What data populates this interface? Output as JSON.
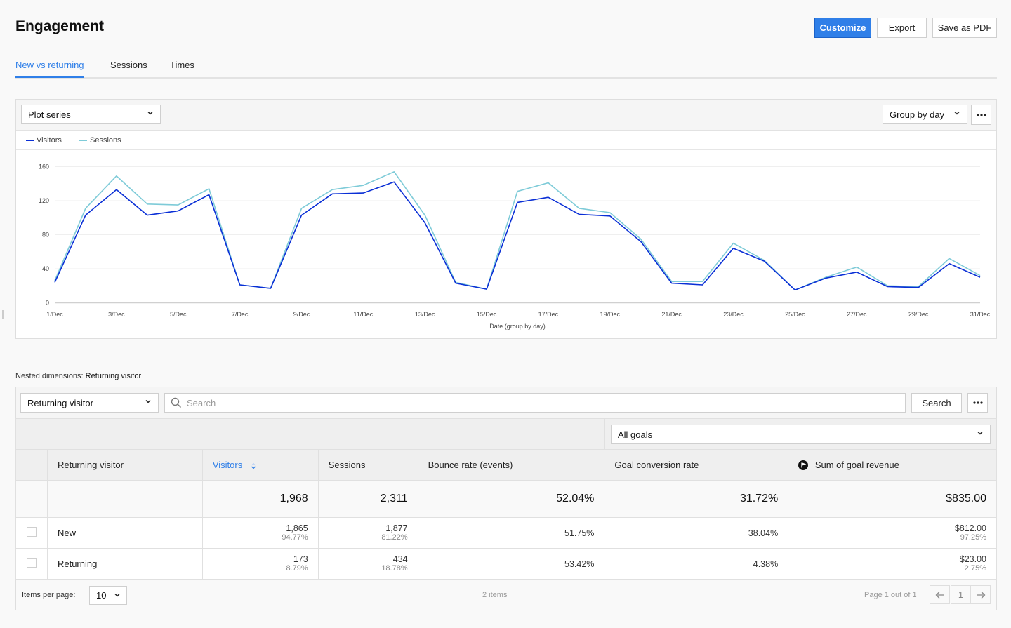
{
  "header": {
    "title": "Engagement",
    "customize_label": "Customize",
    "export_label": "Export",
    "save_pdf_label": "Save as PDF"
  },
  "tabs": [
    {
      "label": "New vs returning",
      "active": true
    },
    {
      "label": "Sessions",
      "active": false
    },
    {
      "label": "Times",
      "active": false
    }
  ],
  "chart_panel": {
    "plot_series_label": "Plot series",
    "group_by_label": "Group by day",
    "more_icon": "ellipsis-icon"
  },
  "colors": {
    "accent": "#2f7fe8",
    "visitors_line": "#0a2fd6",
    "sessions_line": "#7ecbd8"
  },
  "chart_data": {
    "type": "line",
    "title": "",
    "xlabel": "Date (group by day)",
    "ylabel": "",
    "ylim": [
      0,
      160
    ],
    "yticks": [
      0,
      40,
      80,
      120,
      160
    ],
    "grid": true,
    "legend_position": "top-left",
    "x": [
      "1/Dec",
      "2/Dec",
      "3/Dec",
      "4/Dec",
      "5/Dec",
      "6/Dec",
      "7/Dec",
      "8/Dec",
      "9/Dec",
      "10/Dec",
      "11/Dec",
      "12/Dec",
      "13/Dec",
      "14/Dec",
      "15/Dec",
      "16/Dec",
      "17/Dec",
      "18/Dec",
      "19/Dec",
      "20/Dec",
      "21/Dec",
      "22/Dec",
      "23/Dec",
      "24/Dec",
      "25/Dec",
      "26/Dec",
      "27/Dec",
      "28/Dec",
      "29/Dec",
      "30/Dec",
      "31/Dec"
    ],
    "xtick_labels": [
      "1/Dec",
      "3/Dec",
      "5/Dec",
      "7/Dec",
      "9/Dec",
      "11/Dec",
      "13/Dec",
      "15/Dec",
      "17/Dec",
      "19/Dec",
      "21/Dec",
      "23/Dec",
      "25/Dec",
      "27/Dec",
      "29/Dec",
      "31/Dec"
    ],
    "series": [
      {
        "name": "Visitors",
        "values": [
          24,
          103,
          133,
          103,
          108,
          127,
          21,
          17,
          103,
          128,
          129,
          142,
          94,
          23,
          16,
          118,
          124,
          104,
          102,
          72,
          23,
          21,
          64,
          49,
          15,
          29,
          36,
          19,
          18,
          46,
          30
        ]
      },
      {
        "name": "Sessions",
        "values": [
          26,
          111,
          149,
          116,
          115,
          134,
          21,
          17,
          111,
          133,
          138,
          154,
          103,
          24,
          16,
          131,
          141,
          111,
          106,
          75,
          25,
          25,
          70,
          50,
          15,
          30,
          42,
          20,
          19,
          52,
          32
        ]
      }
    ]
  },
  "nested": {
    "prefix": "Nested dimensions:",
    "value": "Returning visitor"
  },
  "table_toolbar": {
    "dimension_select": "Returning visitor",
    "search_placeholder": "Search",
    "search_value": "",
    "search_button": "Search",
    "goals_select": "All goals"
  },
  "table": {
    "columns": [
      {
        "label": "Returning visitor"
      },
      {
        "label": "Visitors",
        "sorted": true
      },
      {
        "label": "Sessions"
      },
      {
        "label": "Bounce rate (events)"
      },
      {
        "label": "Goal conversion rate"
      },
      {
        "label": "Sum of goal revenue",
        "icon": "goal-flag-icon"
      }
    ],
    "totals": {
      "visitors": "1,968",
      "sessions": "2,311",
      "bounce": "52.04%",
      "conversion": "31.72%",
      "revenue": "$835.00"
    },
    "rows": [
      {
        "name": "New",
        "visitors": "1,865",
        "visitors_pct": "94.77%",
        "sessions": "1,877",
        "sessions_pct": "81.22%",
        "bounce": "51.75%",
        "conversion": "38.04%",
        "revenue": "$812.00",
        "revenue_pct": "97.25%"
      },
      {
        "name": "Returning",
        "visitors": "173",
        "visitors_pct": "8.79%",
        "sessions": "434",
        "sessions_pct": "18.78%",
        "bounce": "53.42%",
        "conversion": "4.38%",
        "revenue": "$23.00",
        "revenue_pct": "2.75%"
      }
    ]
  },
  "footer": {
    "items_per_page_label": "Items per page:",
    "items_per_page_value": "10",
    "items_count": "2 items",
    "page_info": "Page 1 out of 1",
    "current_page": "1"
  }
}
